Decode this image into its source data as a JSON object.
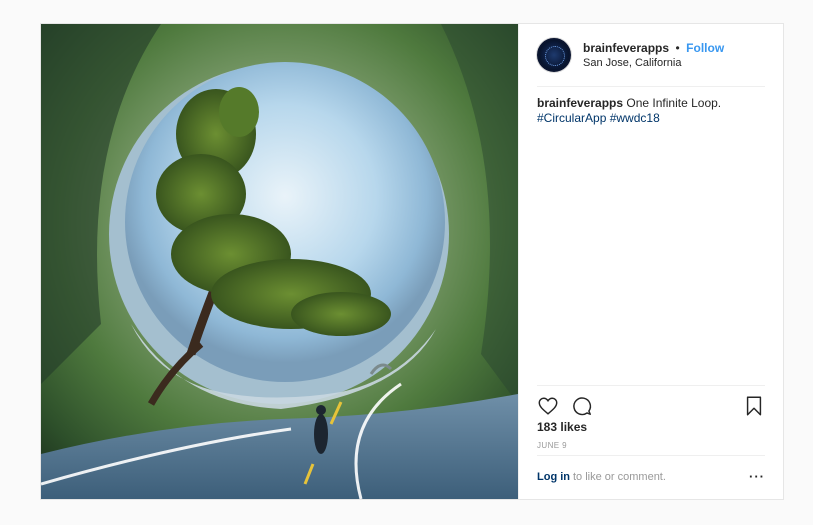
{
  "post": {
    "username": "brainfeverapps",
    "separator": "•",
    "follow_label": "Follow",
    "location": "San Jose, California",
    "caption": {
      "username": "brainfeverapps",
      "text": "One Infinite Loop.",
      "hashtags": [
        "#CircularApp",
        "#wwdc18"
      ]
    },
    "likes": "183 likes",
    "date": "JUNE 9",
    "footer": {
      "login_label": "Log in",
      "prompt": "to like or comment.",
      "more_label": "···"
    },
    "icons": {
      "like": "heart-icon",
      "comment": "comment-icon",
      "save": "bookmark-icon",
      "more": "more-options-icon"
    }
  },
  "colors": {
    "link_blue": "#3897f0",
    "hashtag_blue": "#003569",
    "text": "#262626",
    "muted": "#999999",
    "border": "#efefef",
    "page_bg": "#fafafa"
  }
}
